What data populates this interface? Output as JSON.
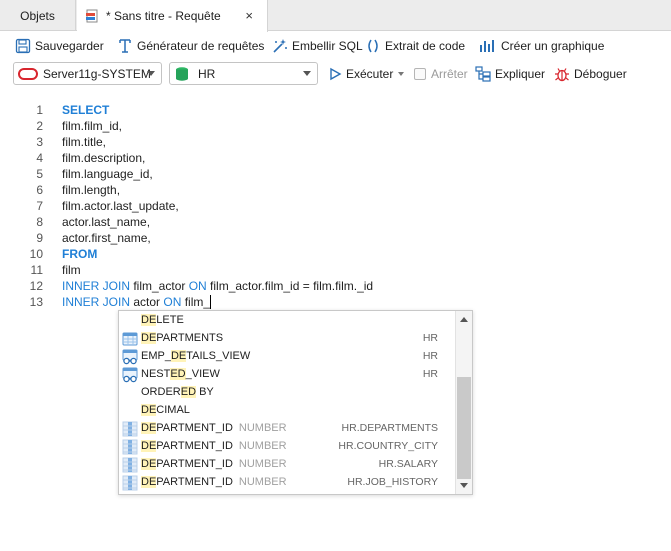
{
  "tabs": {
    "objets": "Objets",
    "query_tab": "* Sans titre - Requête",
    "close": "×"
  },
  "toolbar": {
    "save": "Sauvegarder",
    "query_builder": "Générateur de requêtes",
    "beautify": "Embellir SQL",
    "code_snippet": "Extrait de code",
    "create_chart": "Créer un graphique",
    "connection": "Server11g-SYSTEM",
    "schema": "HR",
    "execute": "Exécuter",
    "stop": "Arrêter",
    "explain": "Expliquer",
    "debug": "Déboguer"
  },
  "colors": {
    "keyword": "#1f7fd6",
    "oracle_red": "#d8262e",
    "schema_green": "#25a35a",
    "highlight": "#fff3b8"
  },
  "editor": {
    "lines": [
      {
        "n": "1",
        "parts": [
          {
            "t": "SELECT",
            "k": true
          }
        ]
      },
      {
        "n": "2",
        "parts": [
          {
            "t": "film.film_id,"
          }
        ]
      },
      {
        "n": "3",
        "parts": [
          {
            "t": "film.title,"
          }
        ]
      },
      {
        "n": "4",
        "parts": [
          {
            "t": "film.description,"
          }
        ]
      },
      {
        "n": "5",
        "parts": [
          {
            "t": "film.language_id,"
          }
        ]
      },
      {
        "n": "6",
        "parts": [
          {
            "t": "film.length,"
          }
        ]
      },
      {
        "n": "7",
        "parts": [
          {
            "t": "film.actor.last_update,"
          }
        ]
      },
      {
        "n": "8",
        "parts": [
          {
            "t": "actor.last_name,"
          }
        ]
      },
      {
        "n": "9",
        "parts": [
          {
            "t": "actor.first_name,"
          }
        ]
      },
      {
        "n": "10",
        "parts": [
          {
            "t": "FROM",
            "k": true
          }
        ]
      },
      {
        "n": "11",
        "parts": [
          {
            "t": "film"
          }
        ]
      },
      {
        "n": "12",
        "parts": [
          {
            "t": "INNER JOIN",
            "k": true
          },
          {
            "t": " film_actor "
          },
          {
            "t": "ON",
            "k": true
          },
          {
            "t": " film_actor.film_id = film.film._id"
          }
        ]
      },
      {
        "n": "13",
        "parts": [
          {
            "t": "INNER JOIN",
            "k": true
          },
          {
            "t": " actor "
          },
          {
            "t": "ON",
            "k": true
          },
          {
            "t": " film_"
          }
        ]
      }
    ]
  },
  "autocomplete": [
    {
      "pre": "",
      "hl": "DE",
      "post": "LETE",
      "type": "",
      "right": "",
      "icon": "none"
    },
    {
      "pre": "",
      "hl": "DE",
      "post": "PARTMENTS",
      "type": "",
      "right": "HR",
      "icon": "table-icon"
    },
    {
      "pre": "EMP_",
      "hl": "DE",
      "post": "TAILS_VIEW",
      "type": "",
      "right": "HR",
      "icon": "view-icon"
    },
    {
      "pre": "NEST",
      "hl": "ED",
      "post": "_VIEW",
      "type": "",
      "right": "HR",
      "icon": "view-icon"
    },
    {
      "pre": "ORDER",
      "hl": "ED",
      "post": " BY",
      "type": "",
      "right": "",
      "icon": "none"
    },
    {
      "pre": "",
      "hl": "DE",
      "post": "CIMAL",
      "type": "",
      "right": "",
      "icon": "none"
    },
    {
      "pre": "",
      "hl": "DE",
      "post": "PARTMENT_ID",
      "type": "NUMBER",
      "right": "HR.DEPARTMENTS",
      "icon": "column-icon"
    },
    {
      "pre": "",
      "hl": "DE",
      "post": "PARTMENT_ID",
      "type": "NUMBER",
      "right": "HR.COUNTRY_CITY",
      "icon": "column-icon"
    },
    {
      "pre": "",
      "hl": "DE",
      "post": "PARTMENT_ID",
      "type": "NUMBER",
      "right": "HR.SALARY",
      "icon": "column-icon"
    },
    {
      "pre": "",
      "hl": "DE",
      "post": "PARTMENT_ID",
      "type": "NUMBER",
      "right": "HR.JOB_HISTORY",
      "icon": "column-icon"
    }
  ]
}
